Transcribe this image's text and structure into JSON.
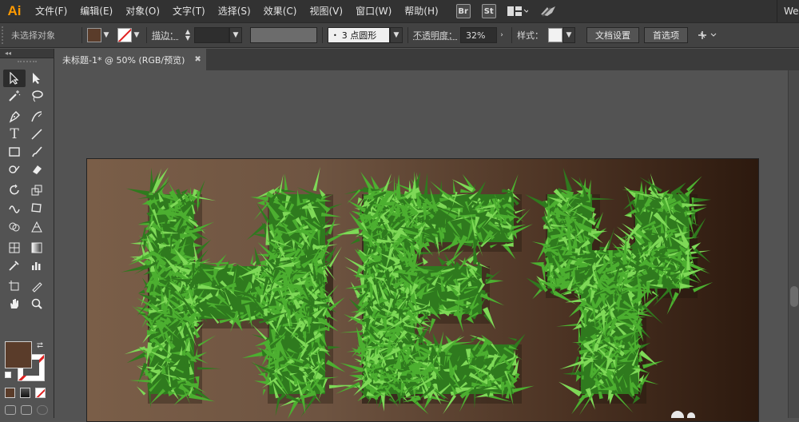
{
  "app": {
    "logo": "Ai",
    "menu": [
      "文件(F)",
      "编辑(E)",
      "对象(O)",
      "文字(T)",
      "选择(S)",
      "效果(C)",
      "视图(V)",
      "窗口(W)",
      "帮助(H)"
    ],
    "bridge_label": "Br",
    "stock_label": "St",
    "workspace": "Web"
  },
  "control_bar": {
    "selection_status": "未选择对象",
    "stroke_label": "描边：",
    "brush_value": "3 点圆形",
    "opacity_label": "不透明度：",
    "opacity_value": "32%",
    "style_label": "样式：",
    "doc_setup_button": "文档设置",
    "preferences_button": "首选项"
  },
  "document": {
    "tab_title": "未标题-1* @ 50% (RGB/预览)",
    "artwork_text": "HEY"
  },
  "colors": {
    "fill": "#5a3c2a",
    "artboard_left": "#7a5e48",
    "artboard_right": "#2c190e",
    "grass_dark": "#2f7a1e",
    "grass_mid": "#4caf30",
    "grass_light": "#7ed957"
  }
}
